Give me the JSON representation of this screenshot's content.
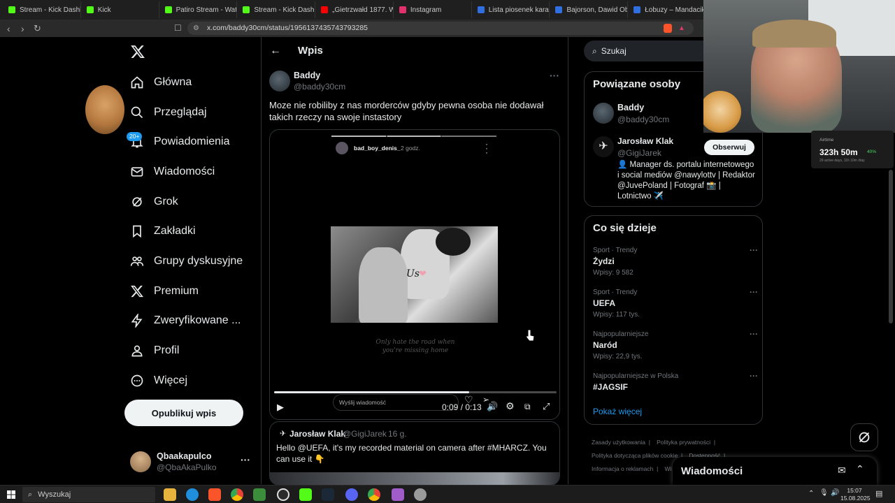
{
  "browser": {
    "tabs": [
      {
        "title": "Stream - Kick Dashboard",
        "color": "#53fc18"
      },
      {
        "title": "Kick",
        "color": "#53fc18"
      },
      {
        "title": "Patiro Stream - Watch",
        "color": "#53fc18"
      },
      {
        "title": "Stream - Kick Dash",
        "color": "#53fc18"
      },
      {
        "title": "„Gietrzwałd 1877. Woj",
        "color": "#ff0000"
      },
      {
        "title": "Instagram",
        "color": "#e1306c"
      },
      {
        "title": "Lista piosenek karaoke",
        "color": "#2f6fe0"
      },
      {
        "title": "Bajorson, Dawid Obse",
        "color": "#2f6fe0"
      },
      {
        "title": "Łobuzy – Mandacik",
        "color": "#2f6fe0"
      }
    ],
    "url": "x.com/baddy30cm/status/1956137435743793285"
  },
  "nav": {
    "items": [
      {
        "label": "Główna",
        "icon": "home-icon"
      },
      {
        "label": "Przeglądaj",
        "icon": "search-icon"
      },
      {
        "label": "Powiadomienia",
        "icon": "bell-icon"
      },
      {
        "label": "Wiadomości",
        "icon": "mail-icon"
      },
      {
        "label": "Grok",
        "icon": "grok-icon"
      },
      {
        "label": "Zakładki",
        "icon": "bookmark-icon"
      },
      {
        "label": "Grupy dyskusyjne",
        "icon": "people-icon"
      },
      {
        "label": "Premium",
        "icon": "x-icon"
      },
      {
        "label": "Zweryfikowane ...",
        "icon": "bolt-icon"
      },
      {
        "label": "Profil",
        "icon": "person-icon"
      },
      {
        "label": "Więcej",
        "icon": "more-icon"
      }
    ],
    "notif_badge": "20+",
    "publish_label": "Opublikuj wpis",
    "account_name": "Qbaakapulco",
    "account_handle": "@QbaAkaPulko"
  },
  "post": {
    "header_title": "Wpis",
    "author_name": "Baddy",
    "author_handle": "@baddy30cm",
    "text": "Moze nie robiliby z nas morderców gdyby pewna osoba nie dodawał takich rzeczy na swoje instastory",
    "story_user": "bad_boy_denis_",
    "story_time": "2 godz.",
    "story_image_caption": "Us",
    "story_caption_line1": "Only hate the road when",
    "story_caption_line2": "you're missing home",
    "story_reply_placeholder": "Wyślij wiadomość",
    "video_time": "0:09 / 0:13",
    "video_progress": 0.69
  },
  "reply": {
    "author_name": "Jarosław Klak",
    "author_handle": "@GigiJarek",
    "time": "16 g.",
    "text": "Hello @UEFA, it's my recorded material on camera after #MHARCZ.  You can use it 👇"
  },
  "right": {
    "search_placeholder": "Szukaj",
    "related_title": "Powiązane osoby",
    "people": [
      {
        "name": "Baddy",
        "handle": "@baddy30cm"
      },
      {
        "name": "Jarosław Klak",
        "handle": "@GigiJarek",
        "bio": "👤 Manager ds. portalu internetowego i social mediów @nawylottv | Redaktor @JuvePoland | Fotograf 📸 | Lotnictwo ✈️",
        "follow_label": "Obserwuj"
      }
    ],
    "trends_title": "Co się dzieje",
    "trends": [
      {
        "category": "Sport · Trendy",
        "name": "Żydzi",
        "count": "Wpisy: 9 582"
      },
      {
        "category": "Sport · Trendy",
        "name": "UEFA",
        "count": "Wpisy: 117 tys."
      },
      {
        "category": "Najpopularniejsze",
        "name": "Naród",
        "count": "Wpisy: 22,9 tys."
      },
      {
        "category": "Najpopularniejsze w Polska",
        "name": "#JAGSIF",
        "count": ""
      }
    ],
    "show_more": "Pokaż więcej",
    "footer_links": [
      "Zasady użytkowania",
      "Polityka prywatności",
      "Polityka dotycząca plików cookie",
      "Dostępność",
      "Informacja o reklamach",
      "Wi"
    ],
    "messages_label": "Wiadomości"
  },
  "overlay": {
    "stats_app": "Airtime",
    "stats_value": "323h 50m",
    "stats_change": "40%",
    "stats_sub": "29 active days, 11h 10m /day"
  },
  "taskbar": {
    "search_label": "Wyszukaj",
    "time": "15:07",
    "date": "15.08.2025"
  },
  "colors": {
    "accent": "#1d9bf0",
    "background": "#000000",
    "border": "#2f3336"
  }
}
